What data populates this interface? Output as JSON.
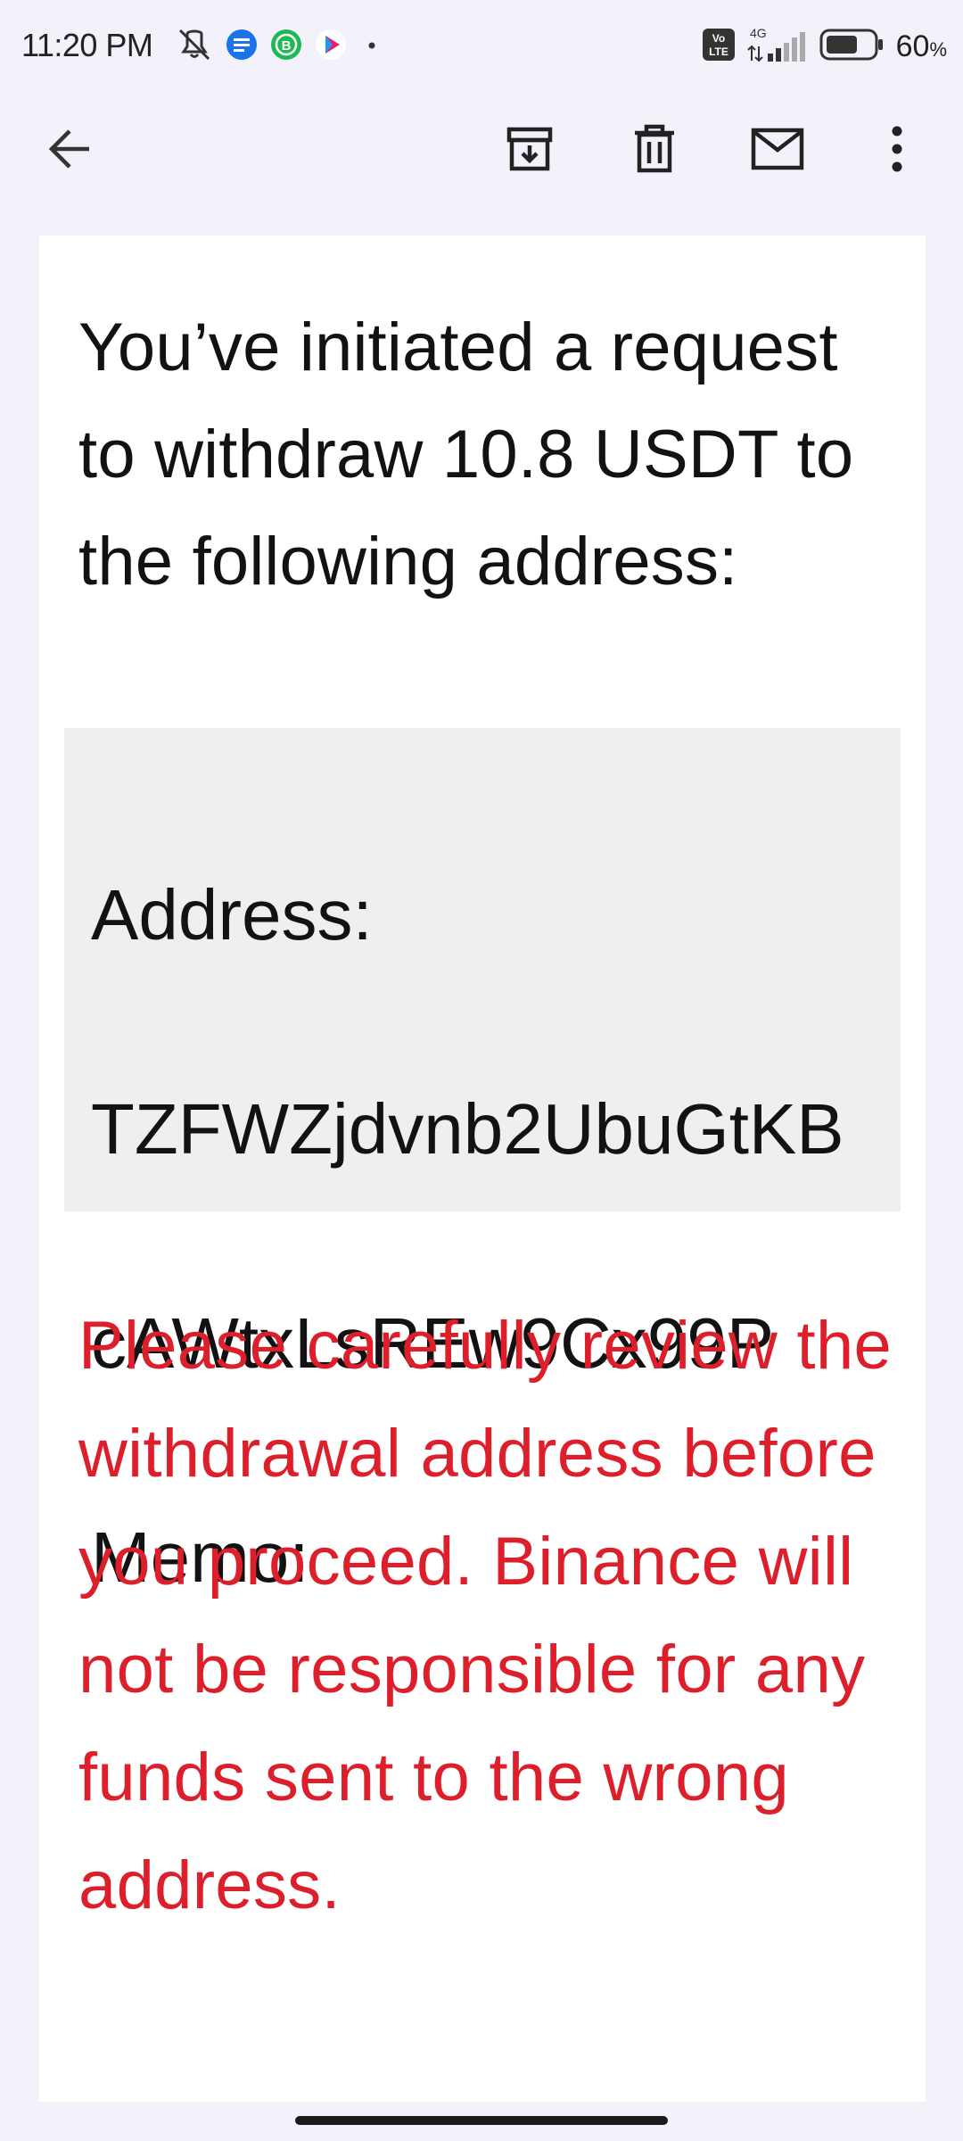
{
  "status_bar": {
    "time": "11:20 PM",
    "network_label_top": "Vo",
    "network_label_bottom": "LTE",
    "network_type": "4G",
    "battery_percent": "60",
    "battery_unit": "%",
    "icons": [
      "mute-icon",
      "messages-icon",
      "b-app-icon",
      "play-icon",
      "dot-icon",
      "signal-icon",
      "battery-icon"
    ]
  },
  "app_bar": {
    "icons": [
      "back-arrow-icon",
      "archive-icon",
      "delete-icon",
      "mail-icon",
      "more-vert-icon"
    ]
  },
  "email": {
    "intro": "You’ve initiated a request to withdraw 10.8 USDT to the following address:",
    "address_label": "Address:",
    "address_line1": "TZFWZjdvnb2UbuGtKB",
    "address_line2": "cAWtxLsREw9Cx99P",
    "memo_label": "Memo:",
    "warning": "Please carefully review the withdrawal address before you proceed. Binance will not be responsible for any funds sent to the wrong address."
  },
  "colors": {
    "warning_text": "#dd1f2b",
    "background": "#f3f1f9",
    "address_box": "#efefef"
  }
}
